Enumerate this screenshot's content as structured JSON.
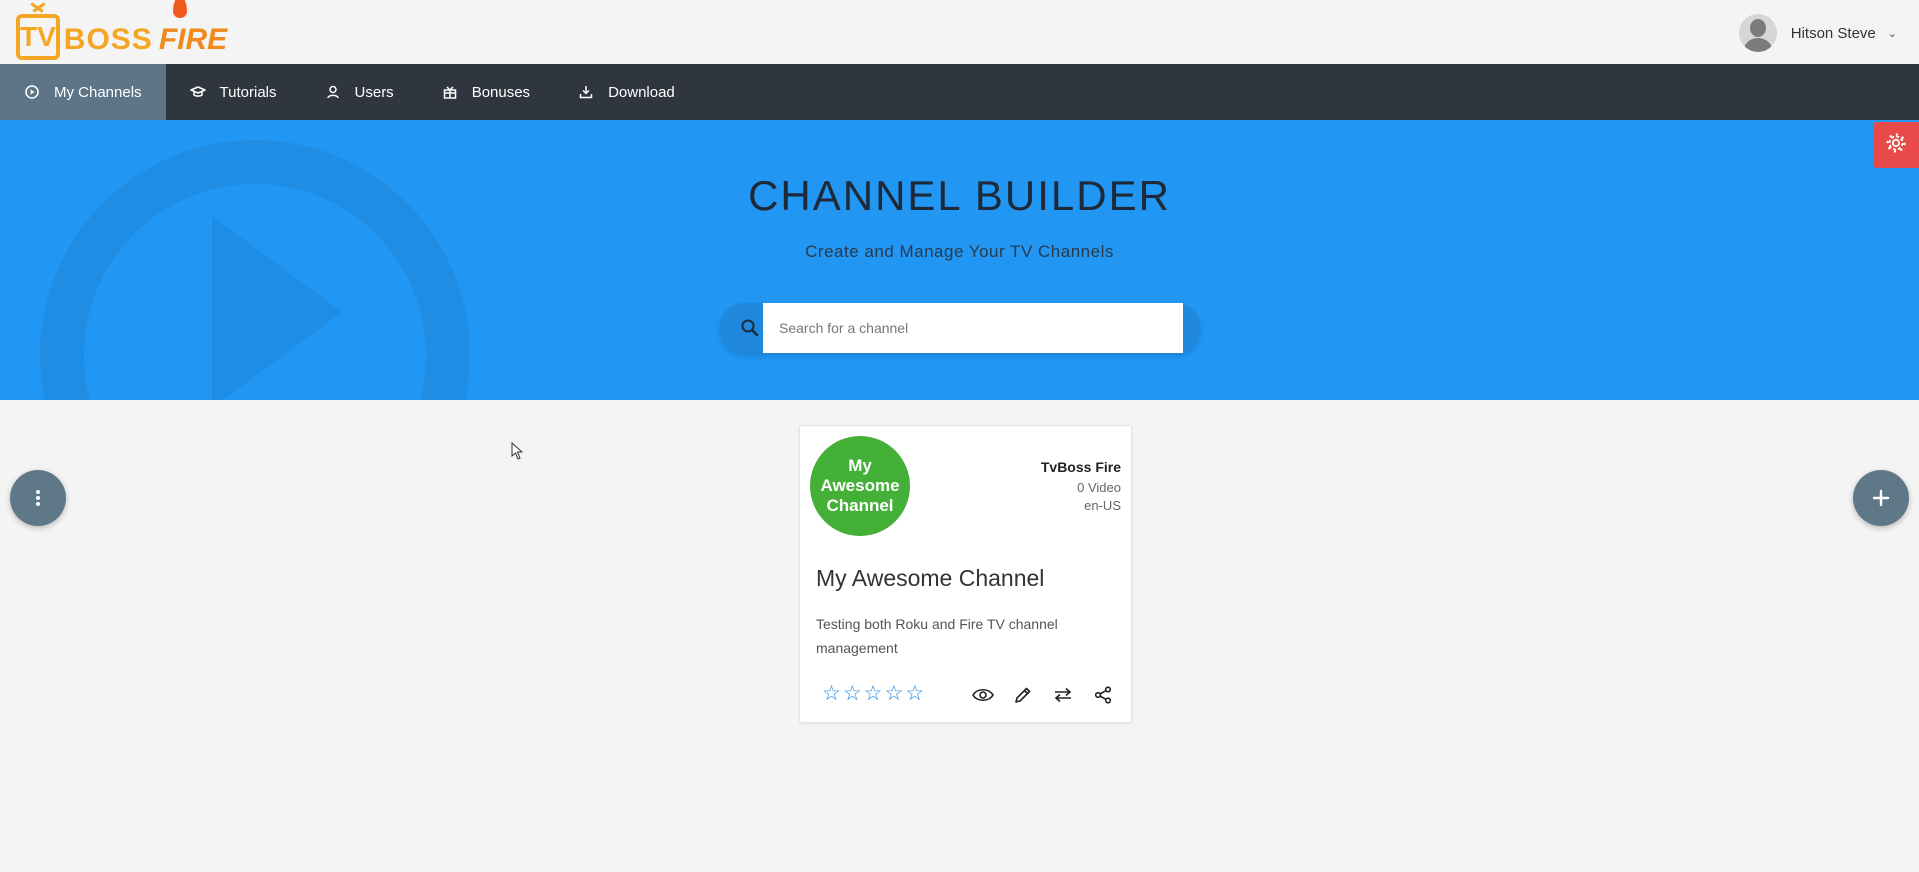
{
  "header": {
    "logo_tv": "TV",
    "logo_boss": "BOSS",
    "logo_fire": "FIRE",
    "user_name": "Hitson Steve"
  },
  "nav": {
    "items": [
      {
        "label": "My Channels",
        "icon": "play-circle-icon",
        "active": true
      },
      {
        "label": "Tutorials",
        "icon": "graduation-cap-icon",
        "active": false
      },
      {
        "label": "Users",
        "icon": "user-icon",
        "active": false
      },
      {
        "label": "Bonuses",
        "icon": "gift-icon",
        "active": false
      },
      {
        "label": "Download",
        "icon": "download-icon",
        "active": false
      }
    ]
  },
  "hero": {
    "title": "CHANNEL BUILDER",
    "subtitle": "Create and Manage Your TV Channels"
  },
  "search": {
    "placeholder": "Search for a channel",
    "value": ""
  },
  "card": {
    "logo_text": "My Awesome Channel",
    "owner": "TvBoss Fire",
    "video_count": "0 Video",
    "locale": "en-US",
    "title": "My Awesome Channel",
    "description": "Testing both Roku and Fire TV channel management",
    "rating": 0,
    "rating_max": 5
  },
  "colors": {
    "navbar": "#2f3640",
    "nav_active": "#5d7587",
    "hero": "#2196f3",
    "logo_green": "#44b038",
    "settings_red": "#e84a4a",
    "fab": "#5f7888"
  }
}
